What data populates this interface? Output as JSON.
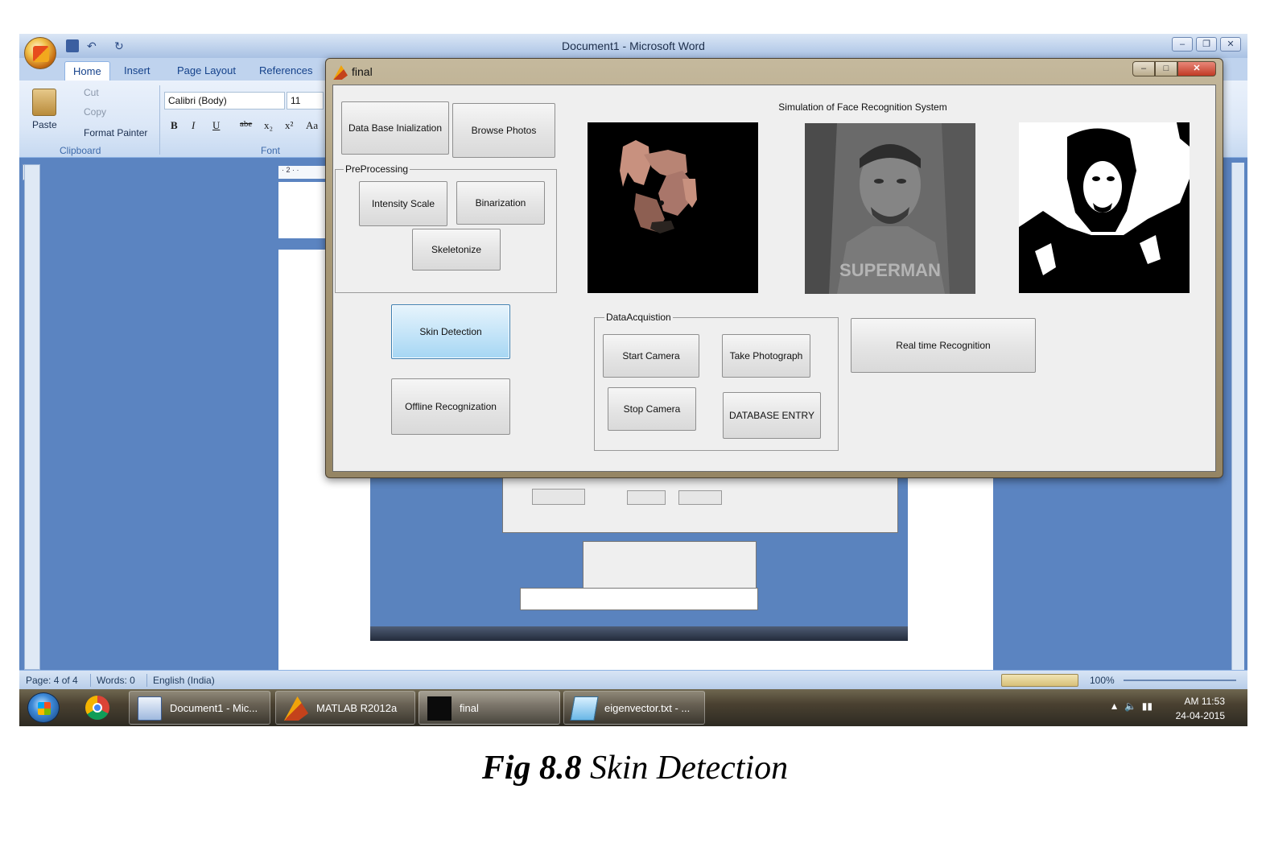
{
  "word": {
    "title": "Document1 - Microsoft Word",
    "tabs": [
      "Home",
      "Insert",
      "Page Layout",
      "References"
    ],
    "clipboard": {
      "paste": "Paste",
      "cut": "Cut",
      "copy": "Copy",
      "format_painter": "Format Painter",
      "group_label": "Clipboard"
    },
    "font": {
      "name": "Calibri (Body)",
      "size": "11",
      "group_label": "Font",
      "bold": "B",
      "italic": "I",
      "underline": "U",
      "strike": "abe",
      "subscript": "x₂",
      "superscript": "x²",
      "case": "Aa"
    },
    "ruler_tab": "L",
    "ruler_top": "· 2 · ·",
    "status": {
      "page": "Page: 4 of 4",
      "words": "Words: 0",
      "language": "English (India)",
      "zoom": "100%"
    }
  },
  "final_window": {
    "title": "final",
    "buttons": {
      "database_init": "Data Base Inialization",
      "browse_photos": "Browse Photos",
      "intensity_scale": "Intensity Scale",
      "binarization": "Binarization",
      "skeletonize": "Skeletonize",
      "skin_detection": "Skin Detection",
      "offline_recognition": "Offline Recognization",
      "start_camera": "Start Camera",
      "take_photograph": "Take Photograph",
      "stop_camera": "Stop Camera",
      "database_entry": "DATABASE ENTRY",
      "real_time_recognition": "Real time Recognition"
    },
    "panels": {
      "preprocessing": "PreProcessing",
      "data_acquisition": "DataAcquistion"
    },
    "simulation_title": "Simulation of Face Recognition System",
    "shirt_text": "SUPERMAN"
  },
  "taskbar": {
    "items": [
      "Document1 - Mic...",
      "MATLAB  R2012a",
      "final",
      "eigenvector.txt - ..."
    ],
    "time": "AM 11:53",
    "date": "24-04-2015"
  },
  "caption": {
    "label": "Fig 8.8",
    "text": " Skin Detection"
  }
}
